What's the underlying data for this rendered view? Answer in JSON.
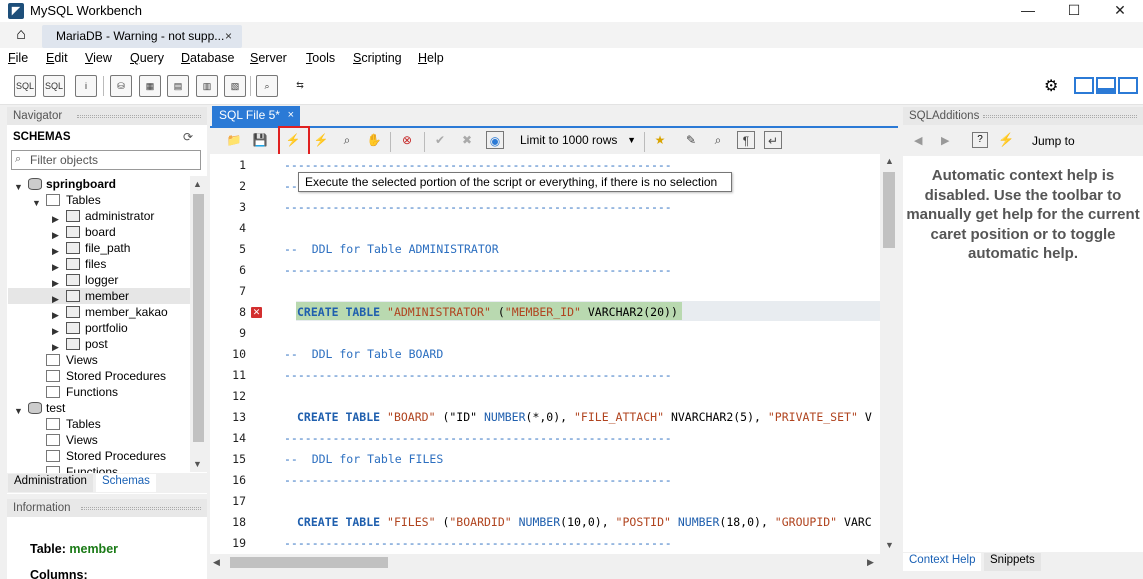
{
  "window": {
    "title": "MySQL Workbench",
    "app_icon": "mysql-dolphin-icon",
    "minimize": "—",
    "maximize": "☐",
    "close": "✕"
  },
  "tabs": {
    "home_icon": "⌂",
    "connection_tab": "MariaDB - Warning - not supp...",
    "close": "×"
  },
  "menu": [
    {
      "label": "File",
      "u": "F",
      "rest": "ile"
    },
    {
      "label": "Edit",
      "u": "E",
      "rest": "dit"
    },
    {
      "label": "View",
      "u": "V",
      "rest": "iew"
    },
    {
      "label": "Query",
      "u": "Q",
      "rest": "uery"
    },
    {
      "label": "Database",
      "u": "D",
      "rest": "atabase"
    },
    {
      "label": "Server",
      "u": "S",
      "rest": "erver"
    },
    {
      "label": "Tools",
      "u": "T",
      "rest": "ools"
    },
    {
      "label": "Scripting",
      "u": "S",
      "rest": "cripting"
    },
    {
      "label": "Help",
      "u": "H",
      "rest": "elp"
    }
  ],
  "main_toolbar": {
    "sql1": "SQL",
    "sql2": "SQL",
    "gear": "⚙"
  },
  "navigator": {
    "header": "Navigator",
    "schemas_label": "SCHEMAS",
    "refresh_icon": "⟳",
    "filter_placeholder": "Filter objects",
    "tree": {
      "springboard": "springboard",
      "tables": "Tables",
      "table_items": [
        "administrator",
        "board",
        "file_path",
        "files",
        "logger",
        "member",
        "member_kakao",
        "portfolio",
        "post"
      ],
      "views": "Views",
      "stored_procedures": "Stored Procedures",
      "functions": "Functions",
      "test": "test",
      "test_tables": "Tables",
      "test_views": "Views",
      "test_stored_procedures": "Stored Procedures",
      "test_functions": "Functions"
    },
    "tab_administration": "Administration",
    "tab_schemas": "Schemas"
  },
  "information": {
    "header": "Information",
    "table_label": "Table:",
    "table_value": "member",
    "columns_label": "Columns:"
  },
  "editor": {
    "tab_label": "SQL File 5*",
    "tab_close": "×",
    "limit": "Limit to 1000 rows",
    "tooltip": "Execute the selected portion of the script or everything, if there is no selection",
    "line_numbers": [
      "1",
      "2",
      "3",
      "4",
      "5",
      "6",
      "7",
      "8",
      "9",
      "10",
      "11",
      "12",
      "13",
      "14",
      "15",
      "16",
      "17",
      "18",
      "19"
    ],
    "code": {
      "dash": "--------------------------------------------------------",
      "l2_prefix": "--",
      "l5": "--  DDL for Table ADMINISTRATOR",
      "l10": "--  DDL for Table BOARD",
      "l15": "--  DDL for Table FILES",
      "create_table": "CREATE TABLE",
      "l8_name": "\"ADMINISTRATOR\"",
      "l8_open": "(",
      "l8_col": "\"MEMBER_ID\"",
      "l8_type": "VARCHAR2(20))",
      "l13_name": "\"BOARD\"",
      "l13_rest1": "(\"ID\" ",
      "l13_num1": "NUMBER",
      "l13_p1": "(*,0), ",
      "l13_s2": "\"FILE_ATTACH\"",
      "l13_t2": " NVARCHAR2(5), ",
      "l13_s3": "\"PRIVATE_SET\"",
      "l13_t3": " V",
      "l18_name": "\"FILES\"",
      "l18_rest1": "(",
      "l18_s1": "\"BOARDID\"",
      "l18_num1": " NUMBER",
      "l18_p1": "(10,0), ",
      "l18_s2": "\"POSTID\"",
      "l18_num2": " NUMBER",
      "l18_p2": "(18,0), ",
      "l18_s3": "\"GROUPID\"",
      "l18_t3": " VARC"
    }
  },
  "sql_additions": {
    "header": "SQLAdditions",
    "jump_to": "Jump to",
    "help_text": "Automatic context help is disabled. Use the toolbar to manually get help for the current caret position or to toggle automatic help.",
    "tab_context_help": "Context Help",
    "tab_snippets": "Snippets"
  },
  "colors": {
    "accent": "#2b7ad6",
    "highlight_red": "#e02020",
    "selection_green": "#b9d9b0",
    "table_value_green": "#1a7a16"
  }
}
